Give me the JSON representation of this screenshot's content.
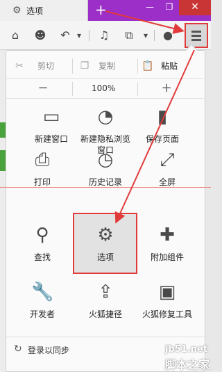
{
  "window": {
    "tab_title": "选项",
    "tab_icon": "gear-icon",
    "new_tab": "+",
    "minimize": "—",
    "maximize": "❐",
    "close": "✕",
    "title_color": "#9b2fc7"
  },
  "toolbar": {
    "home": "⌂",
    "chat": "☻",
    "back": "↶",
    "dropdown": "▾",
    "volume": "♫",
    "crop": "⧉",
    "dropdown2": "▾",
    "speech": "●"
  },
  "menu": {
    "edit": {
      "cut": "剪切",
      "copy": "复制",
      "paste": "粘贴"
    },
    "zoom": {
      "minus": "−",
      "value": "100%",
      "plus": "+"
    },
    "items": [
      {
        "label": "新建窗口",
        "icon": "window-icon"
      },
      {
        "label": "新建隐私浏览\n窗口",
        "icon": "mask-icon"
      },
      {
        "label": "保存页面",
        "icon": "page-icon"
      },
      {
        "label": "打印",
        "icon": "printer-icon"
      },
      {
        "label": "历史记录",
        "icon": "clock-icon"
      },
      {
        "label": "全屏",
        "icon": "fullscreen-icon"
      },
      {
        "label": "查找",
        "icon": "magnifier-icon"
      },
      {
        "label": "选项",
        "icon": "gear-icon"
      },
      {
        "label": "附加组件",
        "icon": "puzzle-icon"
      },
      {
        "label": "开发者",
        "icon": "wrench-icon"
      },
      {
        "label": "火狐捷径",
        "icon": "share-icon"
      },
      {
        "label": "火狐修复工具",
        "icon": "toolbox-icon"
      }
    ],
    "sync": "登录以同步"
  },
  "watermark": {
    "line1": "jb51.net",
    "line2": "脚本之家"
  },
  "accent_red": "#e23a3a"
}
